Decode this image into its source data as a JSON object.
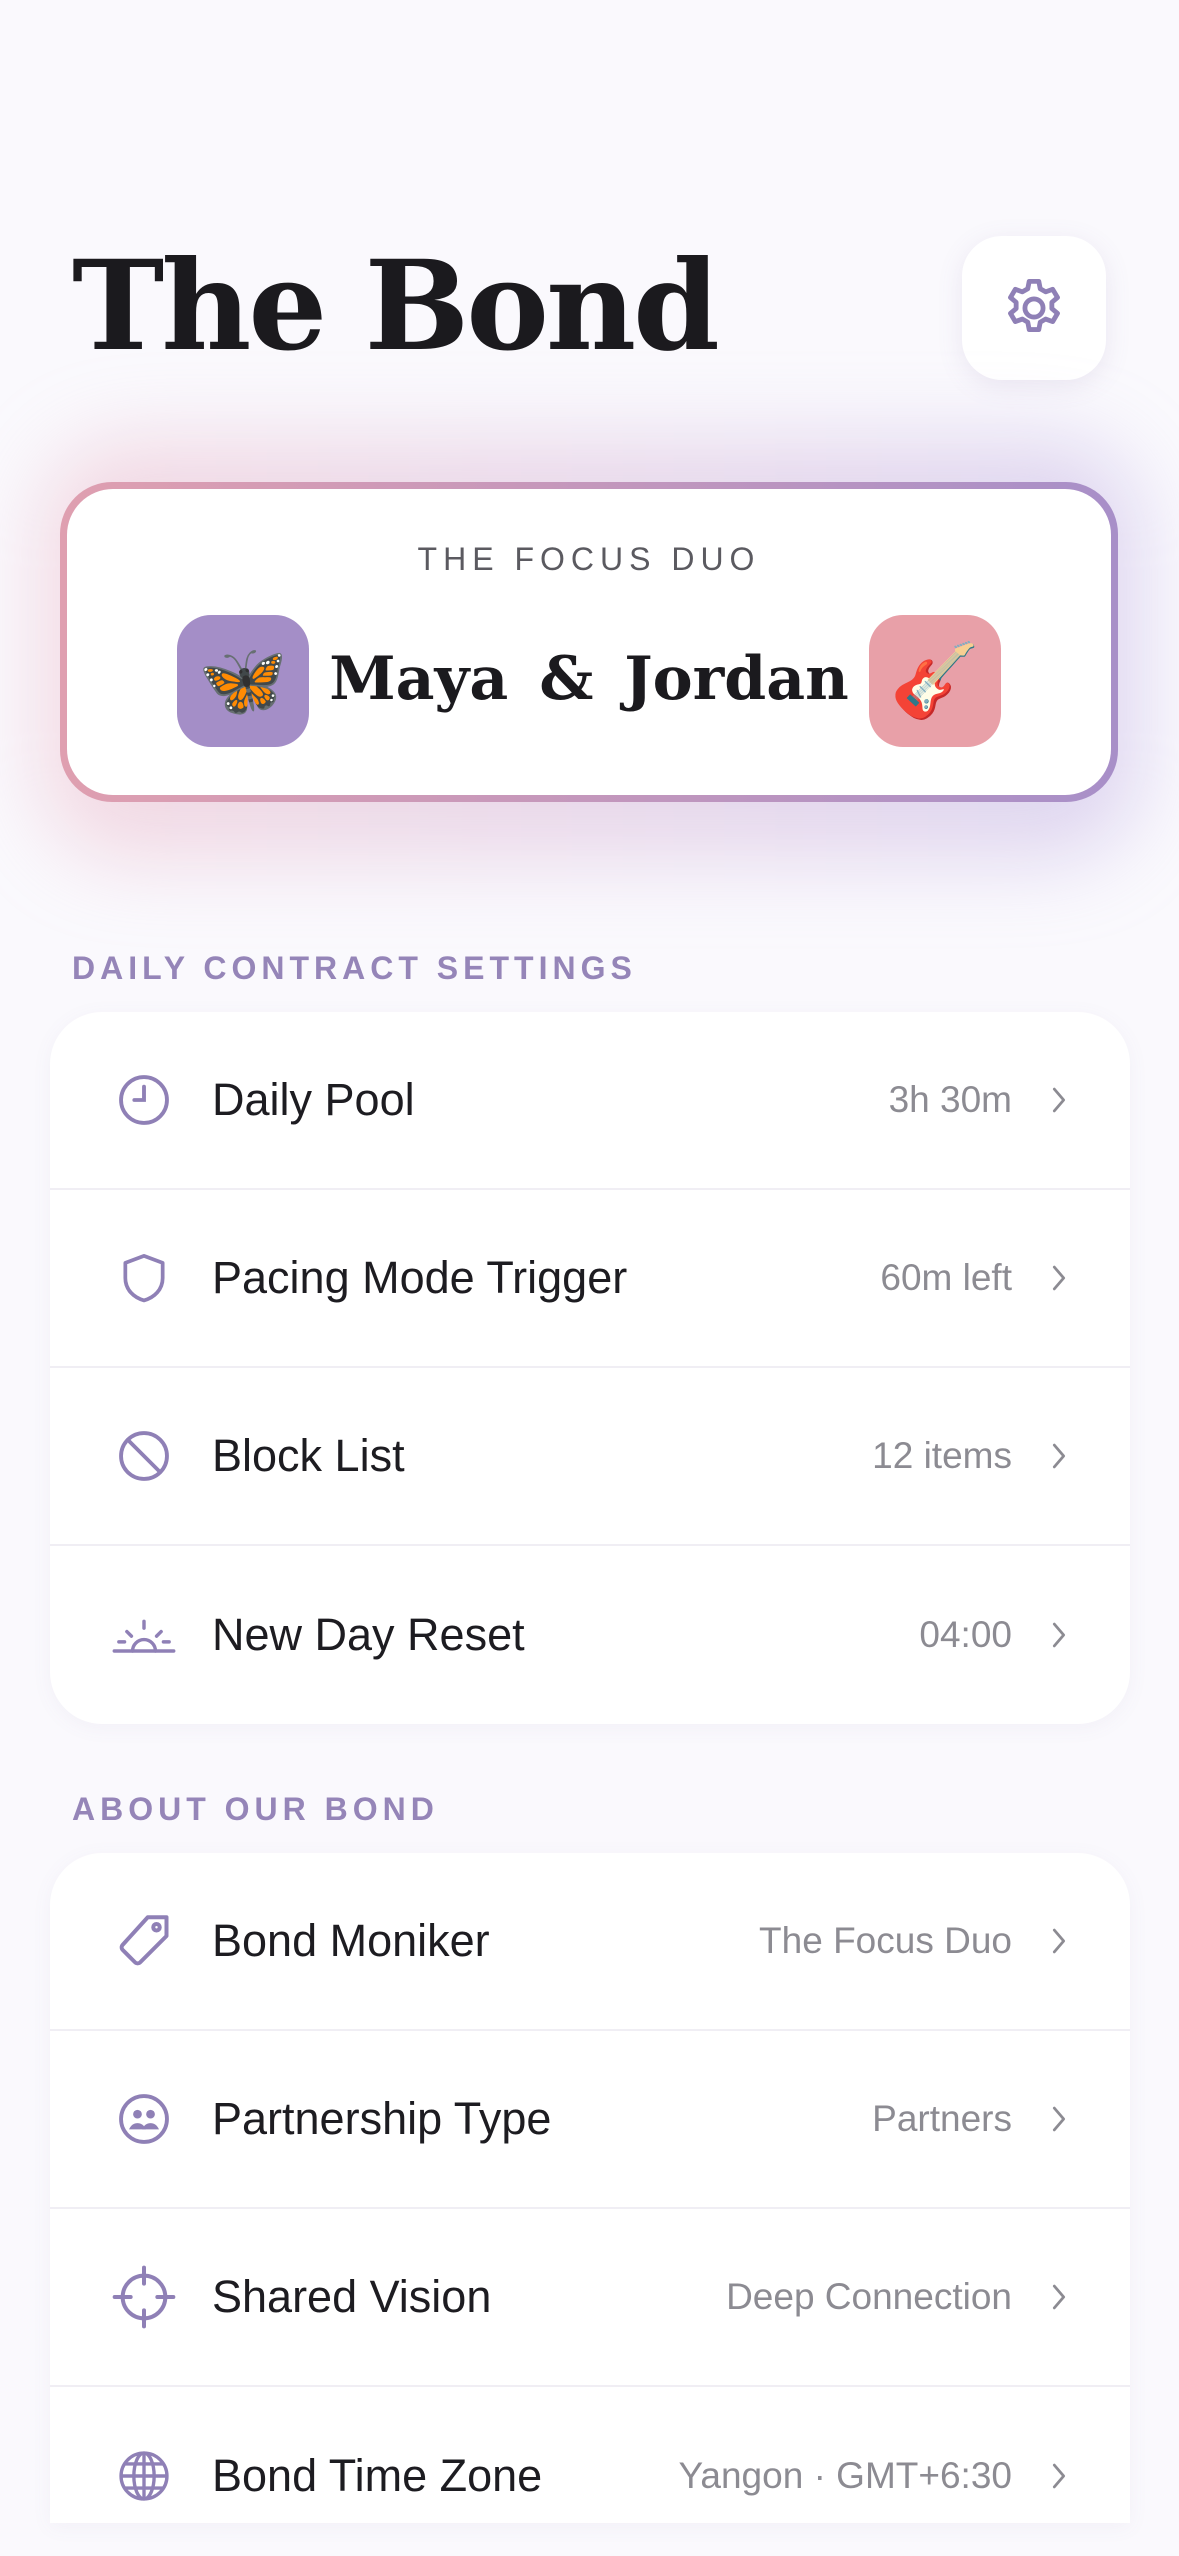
{
  "header": {
    "title": "The Bond",
    "settings_icon": "gear-icon"
  },
  "duo": {
    "label": "THE FOCUS DUO",
    "names": "Maya & Jordan",
    "left_avatar": {
      "icon": "butterfly-icon",
      "emoji": "🦋",
      "color": "#a48ec7"
    },
    "right_avatar": {
      "icon": "guitar-icon",
      "emoji": "🎸",
      "color": "#e8a0a8"
    }
  },
  "daily_contract": {
    "header": "DAILY CONTRACT SETTINGS",
    "items": [
      {
        "label": "Daily Pool",
        "value": "3h 30m",
        "icon": "clock-icon"
      },
      {
        "label": "Pacing Mode Trigger",
        "value": "60m left",
        "icon": "shield-icon"
      },
      {
        "label": "Block List",
        "value": "12 items",
        "icon": "block-icon"
      },
      {
        "label": "New Day Reset",
        "value": "04:00",
        "icon": "sunrise-icon"
      }
    ]
  },
  "about": {
    "header": "ABOUT OUR BOND",
    "items": [
      {
        "label": "Bond Moniker",
        "value": "The Focus Duo",
        "icon": "tag-icon"
      },
      {
        "label": "Partnership Type",
        "value": "Partners",
        "icon": "people-icon"
      },
      {
        "label": "Shared Vision",
        "value": "Deep Connection",
        "icon": "crosshair-icon"
      },
      {
        "label": "Bond Time Zone",
        "value": "Yangon · GMT+6:30",
        "icon": "globe-icon"
      }
    ]
  },
  "colors": {
    "accent": "#8f80b6",
    "section_header": "#9585b8",
    "background": "#faf9fd"
  }
}
